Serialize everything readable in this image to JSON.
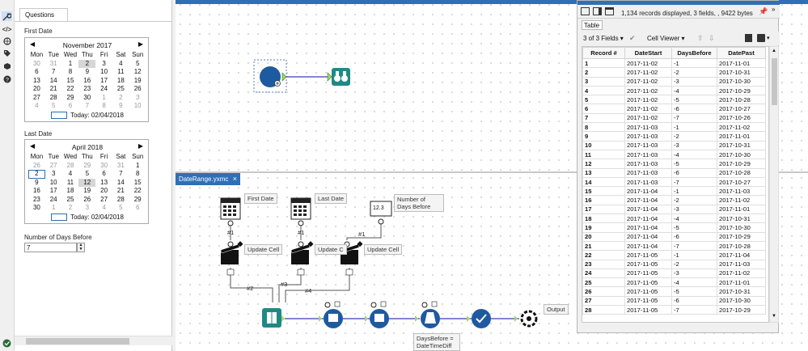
{
  "questions": {
    "tab_label": "Questions",
    "first_date_label": "First Date",
    "last_date_label": "Last Date",
    "days_before_label": "Number of Days Before",
    "days_before_value": "7",
    "first_calendar": {
      "month": "November 2017",
      "today": "Today: 02/04/2018",
      "dow": [
        "Mon",
        "Tue",
        "Wed",
        "Thu",
        "Fri",
        "Sat",
        "Sun"
      ],
      "weeks": [
        [
          "30",
          "31",
          "1",
          "2",
          "3",
          "4",
          "5"
        ],
        [
          "6",
          "7",
          "8",
          "9",
          "10",
          "11",
          "12"
        ],
        [
          "13",
          "14",
          "15",
          "16",
          "17",
          "18",
          "19"
        ],
        [
          "20",
          "21",
          "22",
          "23",
          "24",
          "25",
          "26"
        ],
        [
          "27",
          "28",
          "29",
          "30",
          "1",
          "2",
          "3"
        ],
        [
          "4",
          "5",
          "6",
          "7",
          "8",
          "9",
          "10"
        ]
      ]
    },
    "last_calendar": {
      "month": "April 2018",
      "today": "Today: 02/04/2018",
      "dow": [
        "Mon",
        "Tue",
        "Wed",
        "Thu",
        "Fri",
        "Sat",
        "Sun"
      ],
      "weeks": [
        [
          "26",
          "27",
          "28",
          "29",
          "30",
          "31",
          "1"
        ],
        [
          "2",
          "3",
          "4",
          "5",
          "6",
          "7",
          "8"
        ],
        [
          "9",
          "10",
          "11",
          "12",
          "13",
          "14",
          "15"
        ],
        [
          "16",
          "17",
          "18",
          "19",
          "20",
          "21",
          "22"
        ],
        [
          "23",
          "24",
          "25",
          "26",
          "27",
          "28",
          "29"
        ],
        [
          "30",
          "1",
          "2",
          "3",
          "4",
          "5",
          "6"
        ]
      ]
    }
  },
  "workflow_tab": {
    "title": "DateRange.yxmc",
    "close": "×"
  },
  "tools": {
    "first_date": "First Date",
    "last_date": "Last Date",
    "num_days": "Number of Days Before",
    "num_days_icon": "12.3",
    "update_cell": "Update Cell",
    "update_cell_trunc": "Update C",
    "output": "Output",
    "formula_note": "DaysBefore = DateTimeDiff"
  },
  "connections": {
    "c1": "#1",
    "c2": "#2",
    "c3": "#3",
    "c4": "#4"
  },
  "results": {
    "records_info": "1,134 records displayed, 3 fields, , 9422 bytes",
    "tab_label": "Table",
    "fields_select": "3 of 3 Fields",
    "cell_viewer": "Cell Viewer",
    "columns": [
      "Record #",
      "DateStart",
      "DaysBefore",
      "DatePast"
    ],
    "rows": [
      [
        "1",
        "2017-11-02",
        "-1",
        "2017-11-01"
      ],
      [
        "2",
        "2017-11-02",
        "-2",
        "2017-10-31"
      ],
      [
        "3",
        "2017-11-02",
        "-3",
        "2017-10-30"
      ],
      [
        "4",
        "2017-11-02",
        "-4",
        "2017-10-29"
      ],
      [
        "5",
        "2017-11-02",
        "-5",
        "2017-10-28"
      ],
      [
        "6",
        "2017-11-02",
        "-6",
        "2017-10-27"
      ],
      [
        "7",
        "2017-11-02",
        "-7",
        "2017-10-26"
      ],
      [
        "8",
        "2017-11-03",
        "-1",
        "2017-11-02"
      ],
      [
        "9",
        "2017-11-03",
        "-2",
        "2017-11-01"
      ],
      [
        "10",
        "2017-11-03",
        "-3",
        "2017-10-31"
      ],
      [
        "11",
        "2017-11-03",
        "-4",
        "2017-10-30"
      ],
      [
        "12",
        "2017-11-03",
        "-5",
        "2017-10-29"
      ],
      [
        "13",
        "2017-11-03",
        "-6",
        "2017-10-28"
      ],
      [
        "14",
        "2017-11-03",
        "-7",
        "2017-10-27"
      ],
      [
        "15",
        "2017-11-04",
        "-1",
        "2017-11-03"
      ],
      [
        "16",
        "2017-11-04",
        "-2",
        "2017-11-02"
      ],
      [
        "17",
        "2017-11-04",
        "-3",
        "2017-11-01"
      ],
      [
        "18",
        "2017-11-04",
        "-4",
        "2017-10-31"
      ],
      [
        "19",
        "2017-11-04",
        "-5",
        "2017-10-30"
      ],
      [
        "20",
        "2017-11-04",
        "-6",
        "2017-10-29"
      ],
      [
        "21",
        "2017-11-04",
        "-7",
        "2017-10-28"
      ],
      [
        "22",
        "2017-11-05",
        "-1",
        "2017-11-04"
      ],
      [
        "23",
        "2017-11-05",
        "-2",
        "2017-11-03"
      ],
      [
        "24",
        "2017-11-05",
        "-3",
        "2017-11-02"
      ],
      [
        "25",
        "2017-11-05",
        "-4",
        "2017-11-01"
      ],
      [
        "26",
        "2017-11-05",
        "-5",
        "2017-10-31"
      ],
      [
        "27",
        "2017-11-05",
        "-6",
        "2017-10-30"
      ],
      [
        "28",
        "2017-11-05",
        "-7",
        "2017-10-29"
      ]
    ]
  },
  "colors": {
    "accent": "#2f6fb7",
    "connector": "#3a3ab8",
    "tool_dark": "#1e3f6f",
    "tool_teal": "#1f8a85"
  }
}
